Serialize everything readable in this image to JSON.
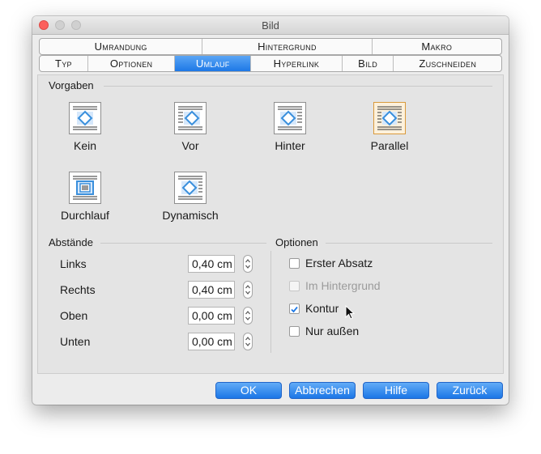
{
  "window": {
    "title": "Bild"
  },
  "tabs": {
    "row1": [
      {
        "label": "Umrandung"
      },
      {
        "label": "Hintergrund"
      },
      {
        "label": "Makro"
      }
    ],
    "row2": [
      {
        "label": "Typ"
      },
      {
        "label": "Optionen"
      },
      {
        "label": "Umlauf",
        "active": true
      },
      {
        "label": "Hyperlink"
      },
      {
        "label": "Bild"
      },
      {
        "label": "Zuschneiden"
      }
    ]
  },
  "vorgaben": {
    "label": "Vorgaben",
    "items": [
      {
        "label": "Kein",
        "icon": "wrap-none-icon"
      },
      {
        "label": "Vor",
        "icon": "wrap-before-icon"
      },
      {
        "label": "Hinter",
        "icon": "wrap-after-icon"
      },
      {
        "label": "Parallel",
        "icon": "wrap-parallel-icon",
        "selected": true
      },
      {
        "label": "Durchlauf",
        "icon": "wrap-through-icon"
      },
      {
        "label": "Dynamisch",
        "icon": "wrap-optimal-icon"
      }
    ]
  },
  "abstaende": {
    "label": "Abstände",
    "fields": [
      {
        "label": "Links",
        "value": "0,40 cm"
      },
      {
        "label": "Rechts",
        "value": "0,40 cm"
      },
      {
        "label": "Oben",
        "value": "0,00 cm"
      },
      {
        "label": "Unten",
        "value": "0,00 cm"
      }
    ]
  },
  "optionen": {
    "label": "Optionen",
    "items": [
      {
        "label": "Erster Absatz",
        "checked": false,
        "enabled": true
      },
      {
        "label": "Im Hintergrund",
        "checked": false,
        "enabled": false
      },
      {
        "label": "Kontur",
        "checked": true,
        "enabled": true
      },
      {
        "label": "Nur außen",
        "checked": false,
        "enabled": true
      }
    ]
  },
  "buttons": {
    "ok": "OK",
    "cancel": "Abbrechen",
    "help": "Hilfe",
    "back": "Zurück"
  },
  "colors": {
    "accent": "#1d78e6",
    "selected_border": "#d99a3c",
    "check": "#1d78e6"
  }
}
